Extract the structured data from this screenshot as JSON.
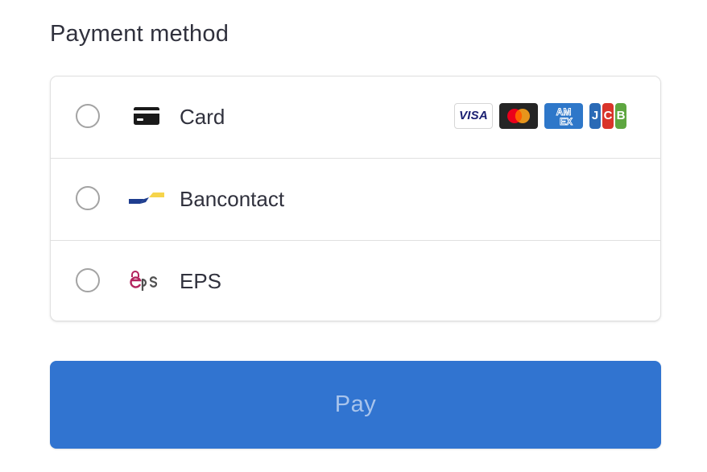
{
  "title": "Payment method",
  "methods": [
    {
      "label": "Card",
      "icon": "card-icon"
    },
    {
      "label": "Bancontact",
      "icon": "bancontact-logo-icon"
    },
    {
      "label": "EPS",
      "icon": "eps-logo-icon"
    }
  ],
  "card_brands": {
    "visa": "VISA",
    "amex_line1": "AM",
    "amex_line2": "EX",
    "jcb": [
      "J",
      "C",
      "B"
    ]
  },
  "pay_button": {
    "label": "Pay"
  },
  "colors": {
    "accent": "#3174d0",
    "pay_label": "#a8c4ec",
    "text": "#30313d",
    "border": "#e0e0e0",
    "radio_border": "#a3a3a3",
    "mastercard_red": "#eb001b",
    "mastercard_orange": "#f79e1b",
    "bancontact_blue": "#1e3d8f",
    "bancontact_yellow": "#f6d44b",
    "eps_pink": "#b3235e",
    "jcb_blue": "#2a6ab6",
    "jcb_red": "#d9342b",
    "jcb_green": "#5ea640"
  }
}
